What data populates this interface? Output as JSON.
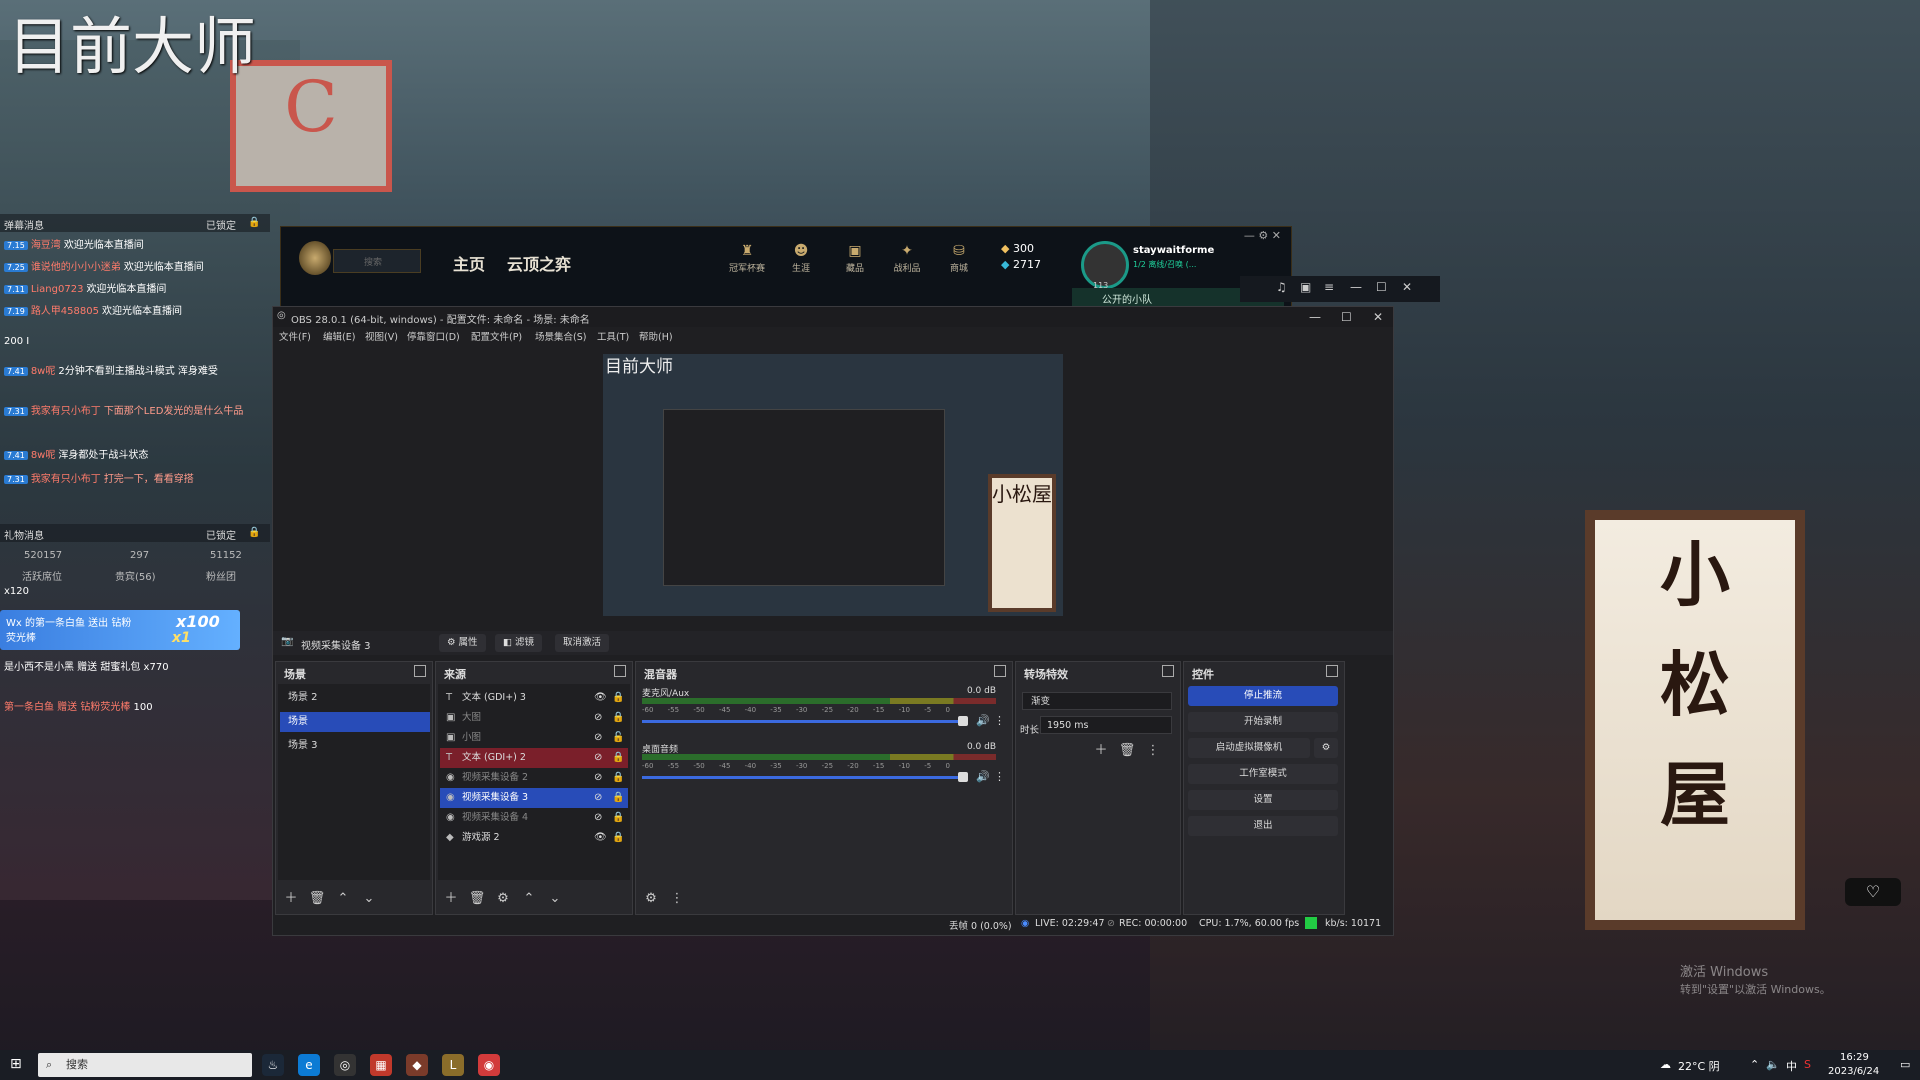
{
  "wallpaper": {
    "overlay_title": "目前大师",
    "sign_char": "C",
    "lantern_chars": [
      "小",
      "松",
      "屋"
    ],
    "preview_lantern_chars": "小松屋"
  },
  "chat": {
    "header_title": "弹幕消息",
    "header_locked": "已锁定",
    "messages": [
      {
        "level": "7.15",
        "user": "海豆湾",
        "text": "欢迎光临本直播间"
      },
      {
        "level": "7.25",
        "user": "谁说他的小小小迷弟",
        "text": "欢迎光临本直播间"
      },
      {
        "level": "7.11",
        "user": "Liang0723",
        "text": "欢迎光临本直播间"
      },
      {
        "level": "7.19",
        "user": "路人甲458805",
        "text": "欢迎光临本直播间"
      },
      {
        "level": "7.41",
        "user": "8w呢",
        "text": "2分钟不看到主播战斗模式 浑身难受"
      },
      {
        "level": "7.31",
        "user": "我家有只小布丁",
        "text": "下面那个LED发光的是什么牛品"
      },
      {
        "level": "7.41",
        "user": "8w呢",
        "text": "浑身都处于战斗状态"
      },
      {
        "level": "7.31",
        "user": "我家有只小布丁",
        "text": "打完一下，看看穿搭"
      }
    ],
    "count_line": "200 I",
    "gift_header": "礼物消息",
    "gift_locked": "已锁定",
    "stats": {
      "coins": "520157",
      "users": "297",
      "likes": "51152"
    },
    "tabs": [
      "活跃席位",
      "贵宾(56)",
      "粉丝团"
    ],
    "gifts": [
      {
        "text": "x120"
      },
      {
        "text": "Wx 的第一条白鱼 送出 钻粉荧光棒",
        "combo": "x100",
        "multiplier": "x1"
      },
      {
        "text": "是小西不是小黑 赠送 甜蜜礼包",
        "count": "x770"
      },
      {
        "text": "第一条白鱼 赠送 钻粉荧光棒",
        "count": "100"
      }
    ]
  },
  "lol": {
    "search_placeholder": "搜索",
    "nav": [
      "主页",
      "云顶之弈"
    ],
    "icons": [
      {
        "name": "trophy",
        "glyph": "♜",
        "label": "冠军杯赛"
      },
      {
        "name": "profile",
        "glyph": "☻",
        "label": "生涯"
      },
      {
        "name": "collection",
        "glyph": "▣",
        "label": "藏品"
      },
      {
        "name": "battlepass",
        "glyph": "✦",
        "label": "战利品"
      },
      {
        "name": "store",
        "glyph": "⛁",
        "label": "商城"
      }
    ],
    "rp": "300",
    "be": "2717",
    "avatar_level": "113",
    "username": "staywaitforme",
    "status": "1/2 离线/召唤 (...",
    "party_label": "公开的小队"
  },
  "obs": {
    "title": "OBS 28.0.1 (64-bit, windows) - 配置文件: 未命名 - 场景: 未命名",
    "menu": [
      "文件(F)",
      "编辑(E)",
      "视图(V)",
      "停靠窗口(D)",
      "配置文件(P)",
      "场景集合(S)",
      "工具(T)",
      "帮助(H)"
    ],
    "preview_title": "目前大师",
    "source_toolbar": {
      "selected_source": "视频采集设备 3",
      "properties": "属性",
      "filters": "滤镜",
      "deactivate": "取消激活"
    },
    "scenes": {
      "title": "场景",
      "items": [
        "场景 2",
        "场景",
        "场景 3"
      ],
      "selected": 1
    },
    "sources": {
      "title": "来源",
      "items": [
        {
          "label": "文本 (GDI+) 3",
          "icon": "T",
          "visible": true,
          "state": ""
        },
        {
          "label": "大图",
          "icon": "▣",
          "visible": false,
          "state": ""
        },
        {
          "label": "小图",
          "icon": "▣",
          "visible": false,
          "state": ""
        },
        {
          "label": "文本 (GDI+) 2",
          "icon": "T",
          "visible": false,
          "state": "red"
        },
        {
          "label": "视频采集设备 2",
          "icon": "◉",
          "visible": false,
          "state": ""
        },
        {
          "label": "视频采集设备 3",
          "icon": "◉",
          "visible": false,
          "state": "sel"
        },
        {
          "label": "视频采集设备 4",
          "icon": "◉",
          "visible": false,
          "state": ""
        },
        {
          "label": "游戏源 2",
          "icon": "◆",
          "visible": true,
          "state": ""
        }
      ]
    },
    "mixer": {
      "title": "混音器",
      "channels": [
        {
          "name": "麦克风/Aux",
          "db": "0.0 dB"
        },
        {
          "name": "桌面音频",
          "db": "0.0 dB"
        }
      ],
      "ticks": "-60 -55 -50 -45 -40 -35 -30 -25 -20 -15 -10 -5 0"
    },
    "transitions": {
      "title": "转场特效",
      "type": "渐变",
      "duration_label": "时长",
      "duration": "1950 ms"
    },
    "controls": {
      "title": "控件",
      "buttons": [
        "停止推流",
        "开始录制",
        "启动虚拟摄像机",
        "工作室模式",
        "设置",
        "退出"
      ]
    },
    "status": {
      "dropped": "丢帧 0 (0.0%)",
      "live": "LIVE: 02:29:47",
      "rec": "REC: 00:00:00",
      "cpu": "CPU: 1.7%, 60.00 fps",
      "kbps": "kb/s: 10171"
    }
  },
  "watermark": {
    "line1": "激活 Windows",
    "line2": "转到\"设置\"以激活 Windows。"
  },
  "taskbar": {
    "search_placeholder": "搜索",
    "weather": "22°C 阴",
    "ime": "中",
    "time": "16:29",
    "date": "2023/6/24"
  }
}
